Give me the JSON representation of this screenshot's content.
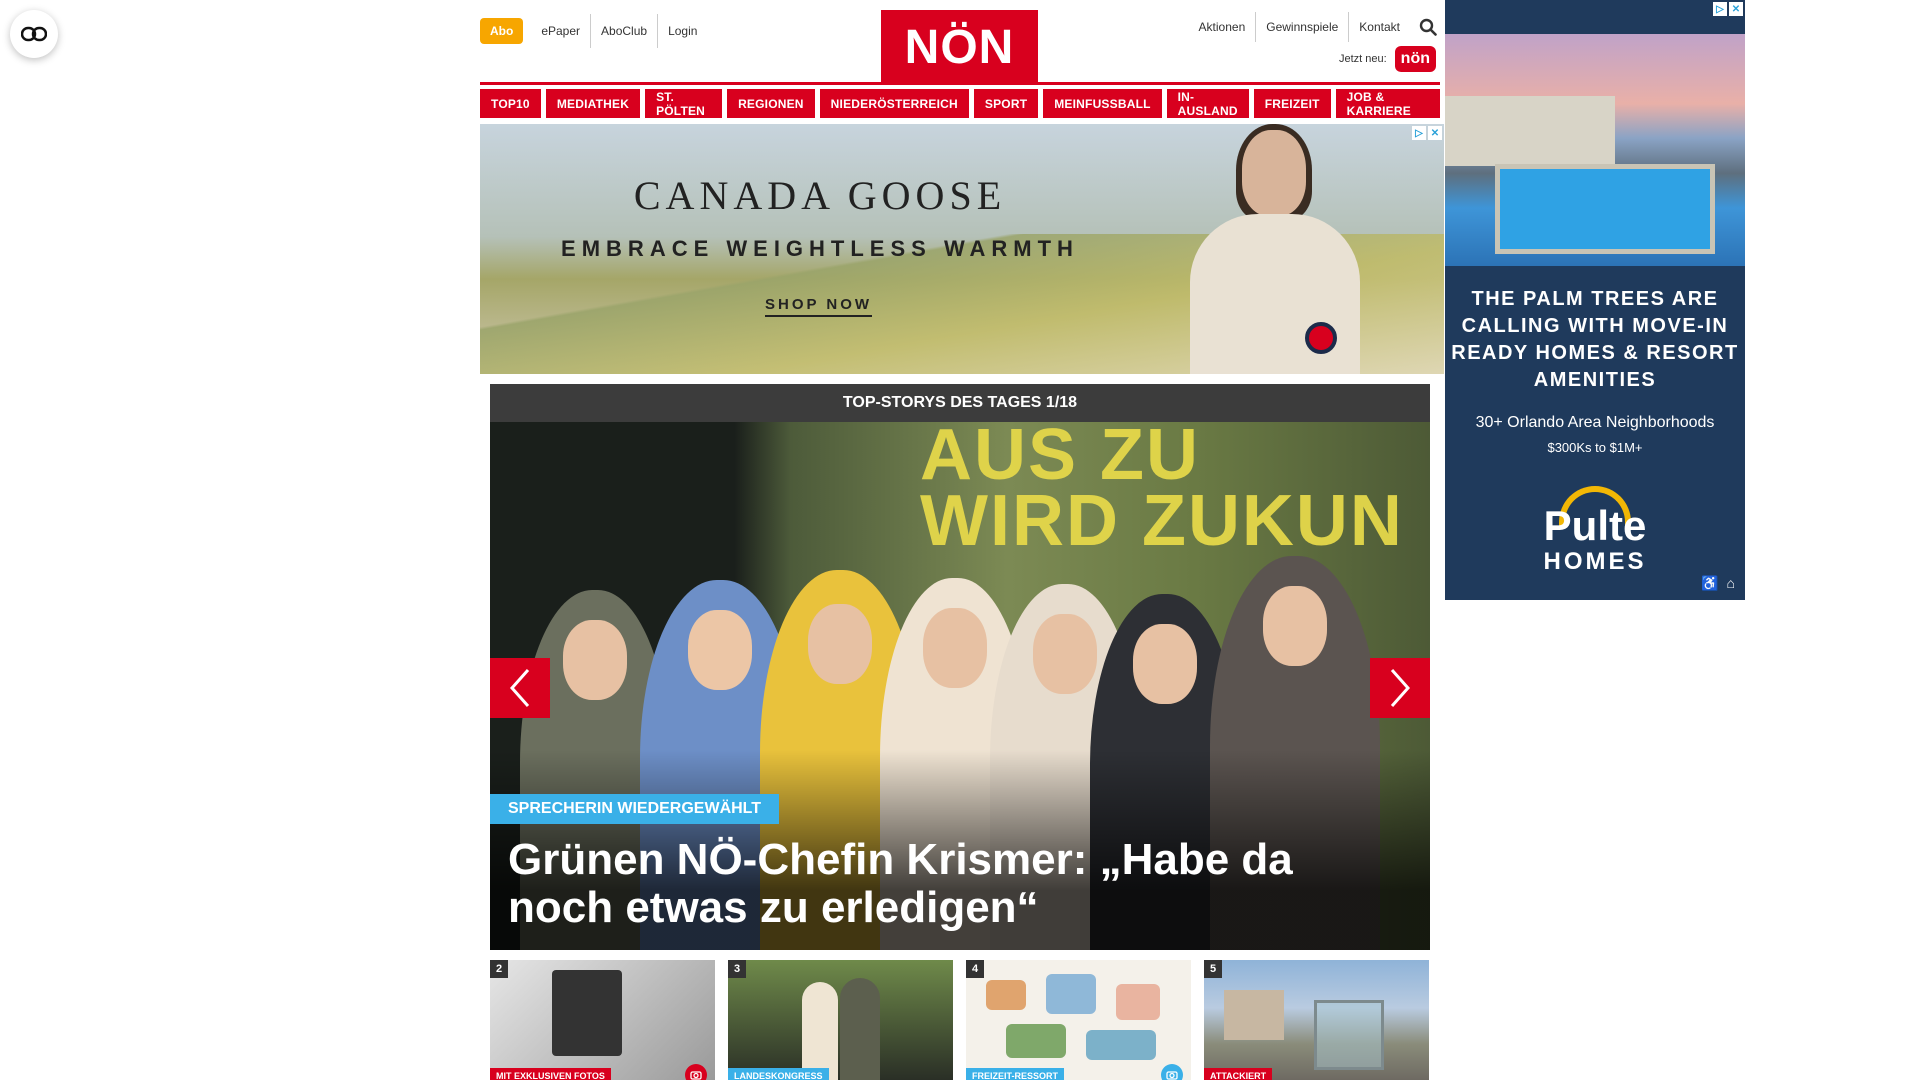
{
  "header": {
    "abo": "Abo",
    "left_links": [
      "ePaper",
      "AboClub",
      "Login"
    ],
    "logo": "NÖN",
    "right_links": [
      "Aktionen",
      "Gewinnspiele",
      "Kontakt"
    ],
    "jetzt_neu": "Jetzt neu:",
    "jetzt_badge": "nön"
  },
  "categories": [
    "TOP10",
    "MEDIATHEK",
    "ST. PÖLTEN",
    "REGIONEN",
    "NIEDERÖSTERREICH",
    "SPORT",
    "MEINFUSSBALL",
    "IN-AUSLAND",
    "FREIZEIT",
    "JOB & KARRIERE"
  ],
  "banner_ad": {
    "brand": "CANADA GOOSE",
    "tagline": "EMBRACE WEIGHTLESS WARMTH",
    "cta": "SHOP NOW"
  },
  "top_stories": {
    "header": "TOP-STORYS DES TAGES 1/18",
    "background_text": "AUS ZU\nWIRD ZUKUN",
    "kicker": "SPRECHERIN WIEDERGEWÄHLT",
    "title": "Grünen NÖ-Chefin Krismer: „Habe da noch etwas zu erledigen“"
  },
  "thumbnails": [
    {
      "num": "2",
      "label": "MIT EXKLUSIVEN FOTOS",
      "label_color": "#d8001e",
      "camera": true
    },
    {
      "num": "3",
      "label": "LANDESKONGRESS",
      "label_color": "#3ab0e8",
      "camera": false
    },
    {
      "num": "4",
      "label": "FREIZEIT-RESSORT",
      "label_color": "#3ab0e8",
      "camera": true
    },
    {
      "num": "5",
      "label": "ATTACKIERT",
      "label_color": "#d8001e",
      "camera": false
    }
  ],
  "side_ad": {
    "headline": "THE PALM TREES ARE CALLING WITH MOVE-IN READY HOMES & RESORT AMENITIES",
    "sub1": "30+ Orlando Area Neighborhoods",
    "sub2": "$300Ks to $1M+",
    "brand": "Pulte",
    "brand2": "HOMES"
  },
  "colors": {
    "accent": "#d8001e",
    "abo": "#f7a600",
    "kicker": "#3ab0e8",
    "header_dark": "#3c3c3c"
  },
  "icons": [
    "accessibility-toggle-icon",
    "search-icon",
    "ad-choices-icon",
    "ad-close-icon",
    "chevron-left-icon",
    "chevron-right-icon",
    "camera-icon"
  ]
}
